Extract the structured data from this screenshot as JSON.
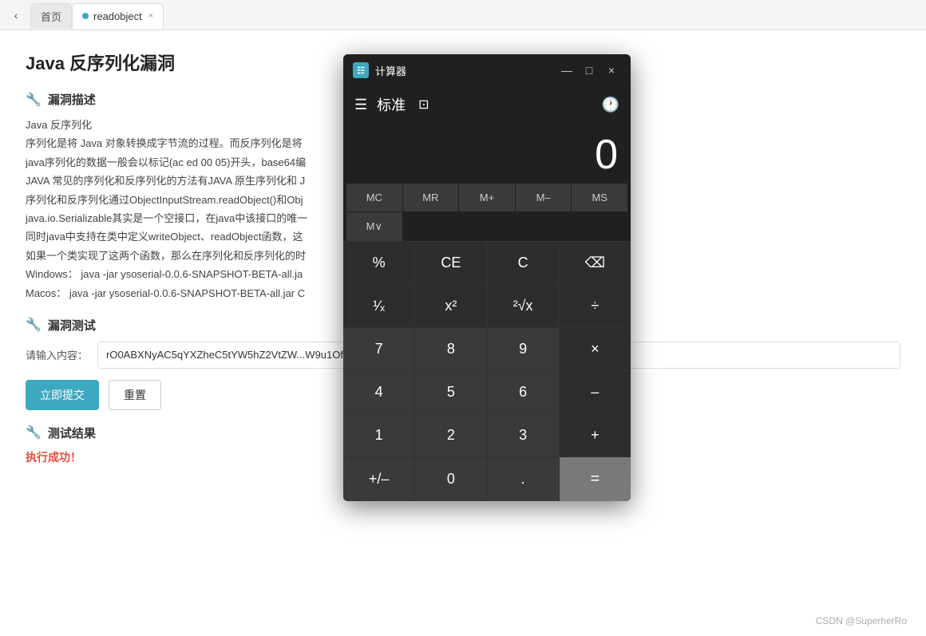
{
  "browser": {
    "tab_home": "首页",
    "tab_active": "readobject",
    "tab_close": "×"
  },
  "page": {
    "title": "Java 反序列化漏洞",
    "vuln_section": "漏洞描述",
    "vuln_icon": "🔧",
    "vuln_text_1": "Java 反序列化",
    "vuln_text_2": "序列化是将 Java 对象转换成字节流的过程。而反序列化是将",
    "vuln_text_3": "java序列化的数据一般会以标记(ac ed 00 05)开头，base64编",
    "vuln_text_4": "JAVA 常见的序列化和反序列化的方法有JAVA 原生序列化和 J",
    "vuln_text_5": "序列化和反序列化通过ObjectInputStream.readObject()和Obj",
    "vuln_text_6": "java.io.Serializable其实是一个空接口，在java中该接口的唯一",
    "vuln_text_7": "同时java中支持在类中定义writeObject、readObject函数，这",
    "vuln_text_8": "如果一个类实现了这两个函数，那么在序列化和反序列化的时",
    "vuln_text_9": "Windows： java -jar ysoserial-0.0.6-SNAPSHOT-BETA-all.ja",
    "vuln_text_10": "Macos：  java -jar ysoserial-0.0.6-SNAPSHOT-BETA-all.jar C",
    "test_section": "漏洞测试",
    "test_icon": "🔧",
    "input_label": "请输入内容：",
    "input_value": "rO0ABXNyAC5qYXZheC5tYW5hZ2VtZW",
    "input_suffix": "W9u1Ofaq2MtRkACAFFMAN2YWx0ABJMamf",
    "btn_submit": "立即提交",
    "btn_reset": "重置",
    "result_section": "测试结果",
    "result_icon": "🔧",
    "result_text": "执行成功！",
    "watermark": "CSDN @SuperherRo"
  },
  "calculator": {
    "title": "计算器",
    "mode": "标准",
    "display": "0",
    "titlebar": {
      "minimize": "—",
      "maximize": "□",
      "close": "×"
    },
    "memory_buttons": [
      "MC",
      "MR",
      "M+",
      "M–",
      "MS",
      "M∨"
    ],
    "buttons": [
      [
        "%",
        "CE",
        "C",
        "⌫"
      ],
      [
        "¹∕ₓ",
        "x²",
        "²√x",
        "÷"
      ],
      [
        "7",
        "8",
        "9",
        "×"
      ],
      [
        "4",
        "5",
        "6",
        "–"
      ],
      [
        "1",
        "2",
        "3",
        "+"
      ],
      [
        "+/–",
        "0",
        ".",
        "="
      ]
    ]
  }
}
